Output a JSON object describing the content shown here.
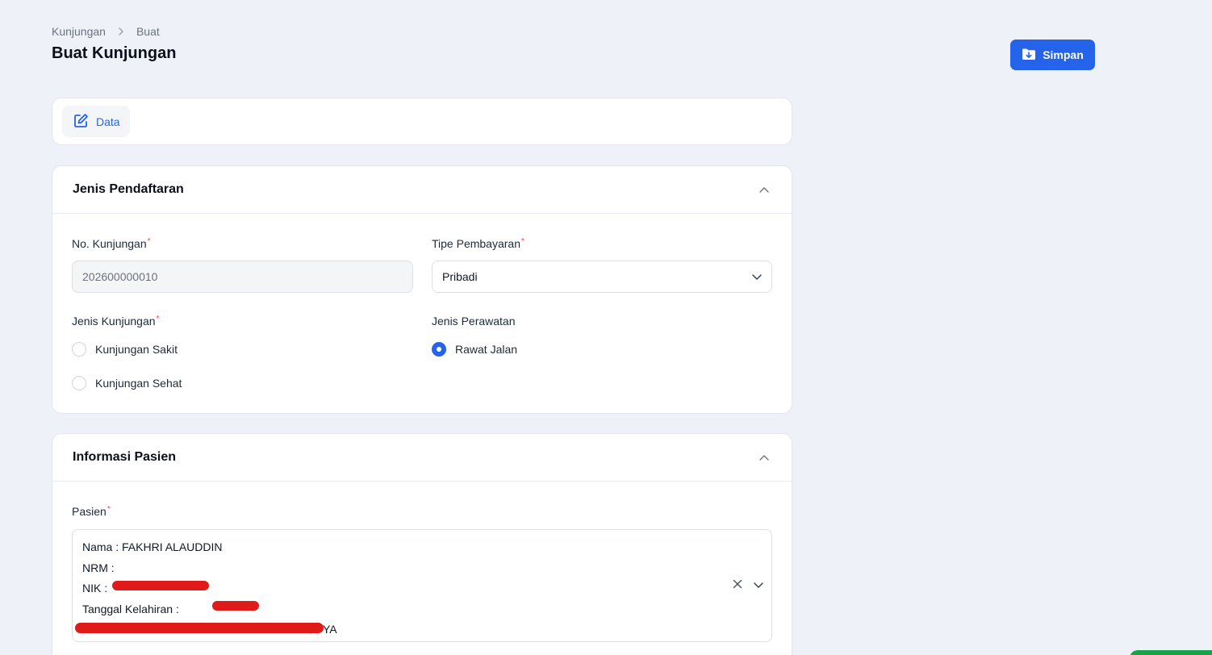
{
  "breadcrumb": {
    "items": [
      "Kunjungan",
      "Buat"
    ]
  },
  "page": {
    "title": "Buat Kunjungan"
  },
  "toolbar": {
    "save_label": "Simpan"
  },
  "tabs": [
    {
      "label": "Data",
      "icon": "edit-icon",
      "active": true
    }
  ],
  "jenis_pendaftaran": {
    "title": "Jenis Pendaftaran",
    "no_kunjungan": {
      "label": "No. Kunjungan",
      "required": "*",
      "value": "202600000010"
    },
    "tipe_pembayaran": {
      "label": "Tipe Pembayaran",
      "required": "*",
      "value": "Pribadi"
    },
    "jenis_kunjungan": {
      "label": "Jenis Kunjungan",
      "required": "*",
      "options": [
        {
          "label": "Kunjungan Sakit",
          "checked": false
        },
        {
          "label": "Kunjungan Sehat",
          "checked": false
        }
      ]
    },
    "jenis_perawatan": {
      "label": "Jenis Perawatan",
      "options": [
        {
          "label": "Rawat Jalan",
          "checked": true
        }
      ]
    }
  },
  "informasi_pasien": {
    "title": "Informasi Pasien",
    "pasien": {
      "label": "Pasien",
      "required": "*",
      "lines": [
        "Nama : FAKHRI ALAUDDIN",
        "NRM :",
        "NIK :",
        "Tanggal Kelahiran :",
        "YA"
      ]
    }
  },
  "colors": {
    "primary": "#2563eb",
    "background": "#eef1f7",
    "required": "#ef4444",
    "redaction": "#e01919"
  }
}
